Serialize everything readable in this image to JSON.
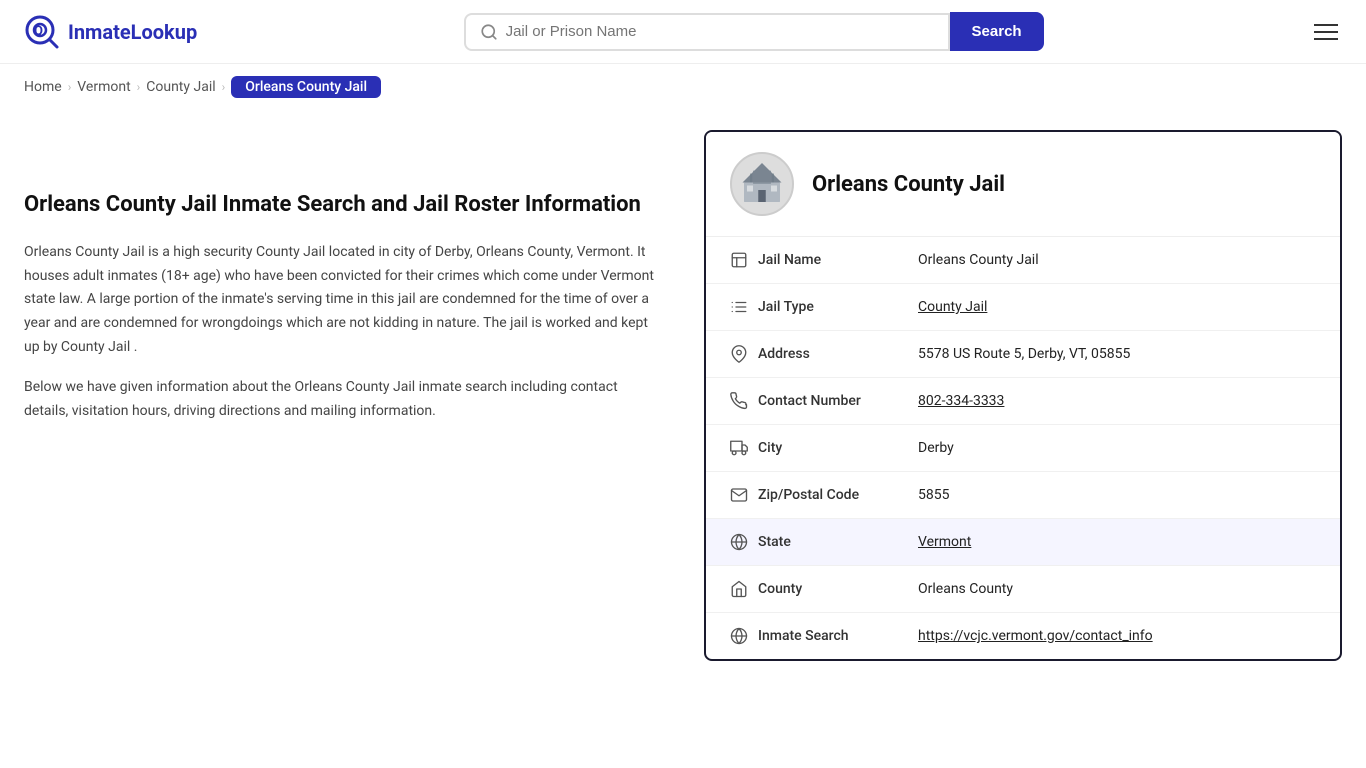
{
  "logo": {
    "text": "InmateLookup"
  },
  "search": {
    "placeholder": "Jail or Prison Name",
    "button_label": "Search"
  },
  "breadcrumb": {
    "items": [
      {
        "label": "Home",
        "href": "#"
      },
      {
        "label": "Vermont",
        "href": "#"
      },
      {
        "label": "County Jail",
        "href": "#"
      },
      {
        "label": "Orleans County Jail",
        "href": "#"
      }
    ]
  },
  "menu_label": "Menu",
  "left": {
    "heading": "Orleans County Jail Inmate Search and Jail Roster Information",
    "para1": "Orleans County Jail is a high security County Jail located in city of Derby, Orleans County, Vermont. It houses adult inmates (18+ age) who have been convicted for their crimes which come under Vermont state law. A large portion of the inmate's serving time in this jail are condemned for the time of over a year and are condemned for wrongdoings which are not kidding in nature. The jail is worked and kept up by County Jail .",
    "para2": "Below we have given information about the Orleans County Jail inmate search including contact details, visitation hours, driving directions and mailing information."
  },
  "card": {
    "title": "Orleans County Jail",
    "rows": [
      {
        "label": "Jail Name",
        "value": "Orleans County Jail",
        "link": null,
        "icon": "jail-icon",
        "highlighted": false
      },
      {
        "label": "Jail Type",
        "value": "County Jail",
        "link": "#",
        "icon": "list-icon",
        "highlighted": false
      },
      {
        "label": "Address",
        "value": "5578 US Route 5, Derby, VT, 05855",
        "link": null,
        "icon": "location-icon",
        "highlighted": false
      },
      {
        "label": "Contact Number",
        "value": "802-334-3333",
        "link": "tel:8023343333",
        "icon": "phone-icon",
        "highlighted": false
      },
      {
        "label": "City",
        "value": "Derby",
        "link": null,
        "icon": "city-icon",
        "highlighted": false
      },
      {
        "label": "Zip/Postal Code",
        "value": "5855",
        "link": null,
        "icon": "mail-icon",
        "highlighted": false
      },
      {
        "label": "State",
        "value": "Vermont",
        "link": "#",
        "icon": "globe-icon",
        "highlighted": true
      },
      {
        "label": "County",
        "value": "Orleans County",
        "link": null,
        "icon": "county-icon",
        "highlighted": false
      },
      {
        "label": "Inmate Search",
        "value": "https://vcjc.vermont.gov/contact_info",
        "link": "https://vcjc.vermont.gov/contact_info",
        "icon": "search-globe-icon",
        "highlighted": false
      }
    ]
  }
}
